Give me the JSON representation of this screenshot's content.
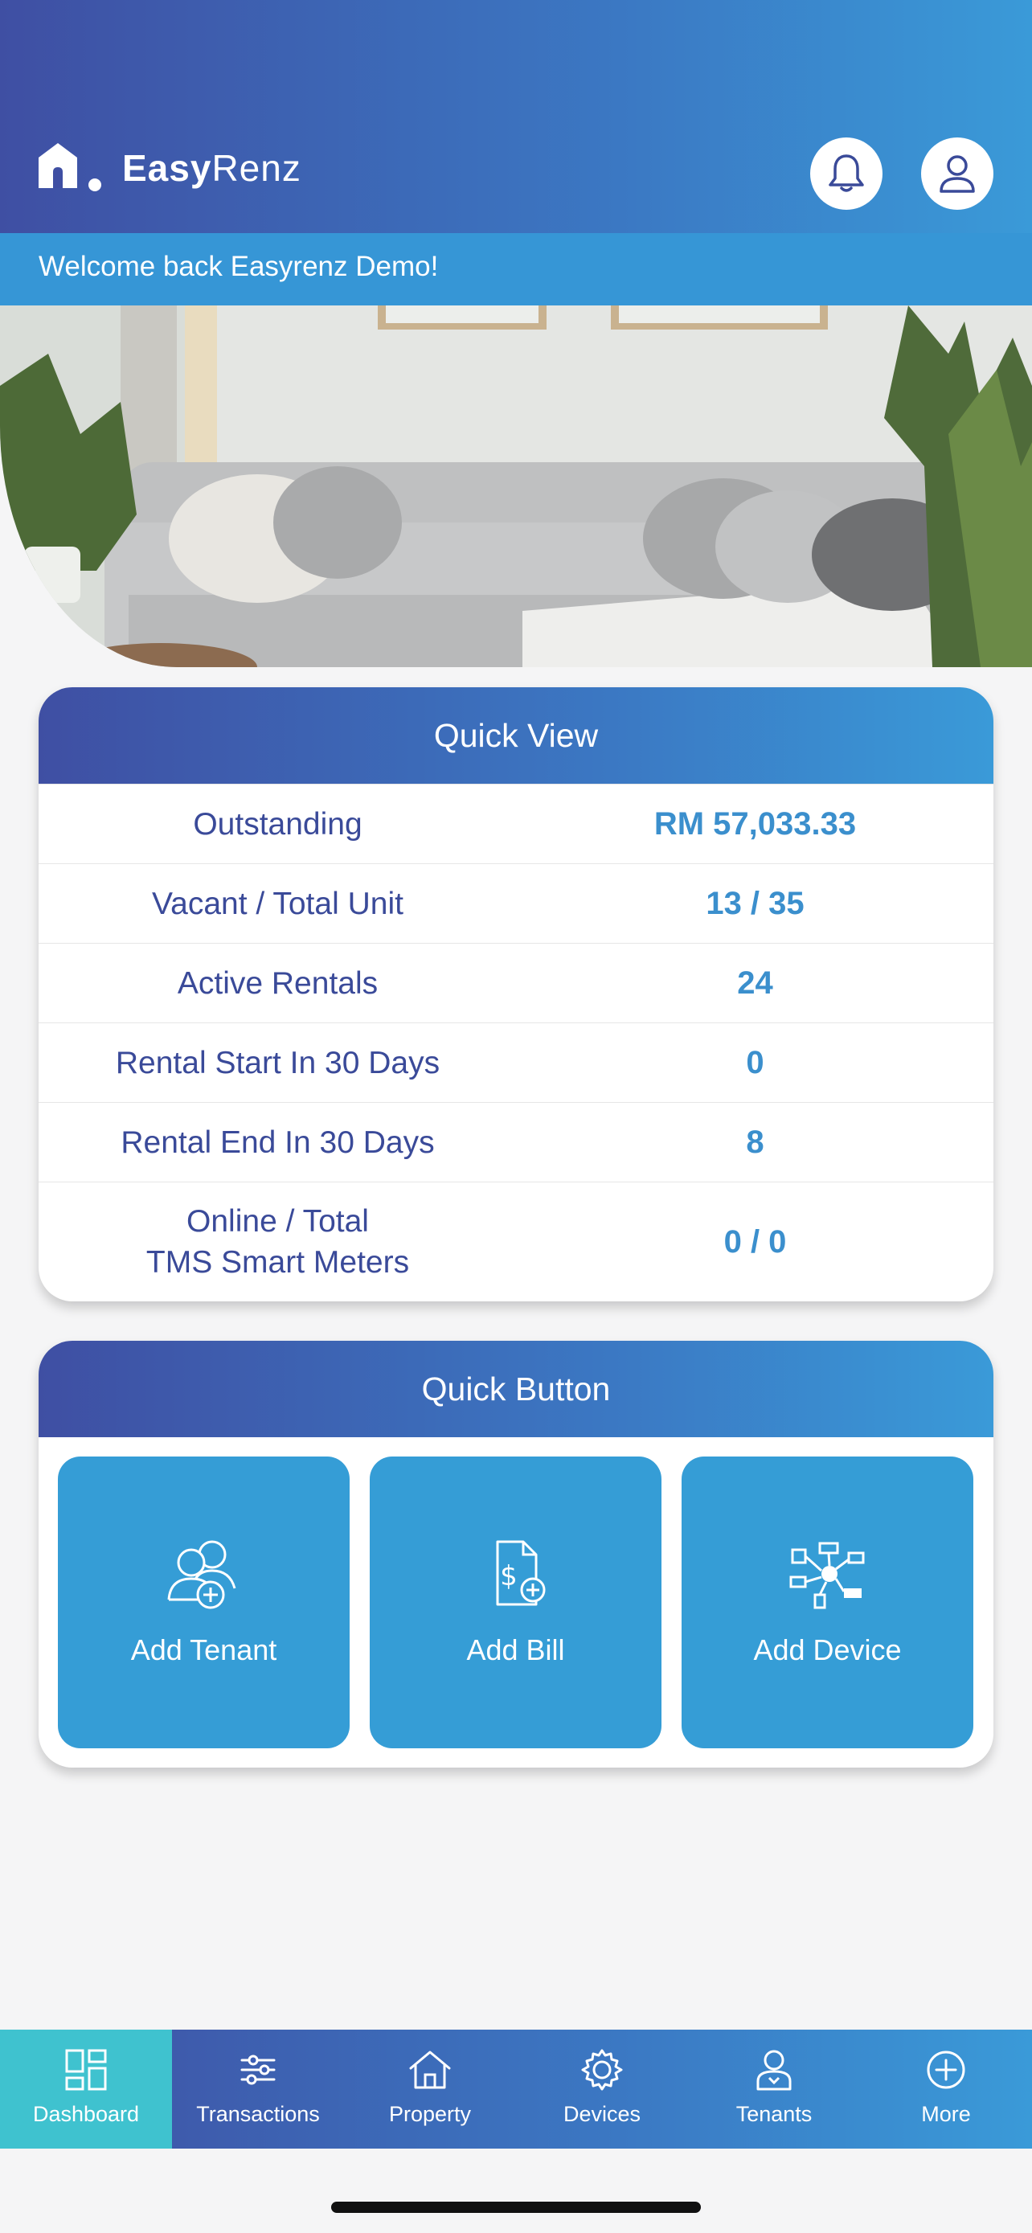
{
  "app": {
    "name_bold": "Easy",
    "name_rest": "Renz",
    "welcome": "Welcome back Easyrenz Demo!"
  },
  "header": {
    "notification_icon": "bell-icon",
    "profile_icon": "user-icon"
  },
  "quick_view": {
    "title": "Quick View",
    "rows": [
      {
        "label": "Outstanding",
        "value": "RM 57,033.33"
      },
      {
        "label": "Vacant / Total Unit",
        "value": "13 / 35"
      },
      {
        "label": "Active Rentals",
        "value": "24"
      },
      {
        "label": "Rental Start In 30 Days",
        "value": "0"
      },
      {
        "label": "Rental End In 30 Days",
        "value": "8"
      },
      {
        "label_line1": "Online / Total",
        "label_line2": "TMS Smart Meters",
        "value": "0 / 0"
      }
    ]
  },
  "quick_button": {
    "title": "Quick Button",
    "buttons": [
      {
        "label": "Add Tenant",
        "icon": "add-tenant-icon"
      },
      {
        "label": "Add Bill",
        "icon": "add-bill-icon"
      },
      {
        "label": "Add Device",
        "icon": "add-device-icon"
      }
    ]
  },
  "nav": {
    "active": "Dashboard",
    "items": [
      {
        "label": "Dashboard",
        "icon": "dashboard-icon"
      },
      {
        "label": "Transactions",
        "icon": "transactions-icon"
      },
      {
        "label": "Property",
        "icon": "home-icon"
      },
      {
        "label": "Devices",
        "icon": "gear-icon"
      },
      {
        "label": "Tenants",
        "icon": "tenant-icon"
      },
      {
        "label": "More",
        "icon": "plus-circle-icon"
      }
    ]
  },
  "colors": {
    "primary_dark": "#3f4fa3",
    "primary_light": "#3a9ad8",
    "button_blue": "#359dd6",
    "active_tab": "#3fc2cf",
    "label_text": "#3a4a99",
    "value_text": "#3b8fcd"
  }
}
